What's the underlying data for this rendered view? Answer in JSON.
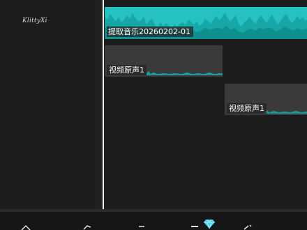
{
  "watermark": {
    "text": "KlittyXi"
  },
  "timeline": {
    "music_clip": {
      "label": "提取音乐20260202-01",
      "color": "#1aa0a0"
    },
    "video_clips": [
      {
        "label": "视频原声1"
      },
      {
        "label": "视频原声1"
      }
    ],
    "playhead_color": "#f2f2f2"
  },
  "toolbar": {
    "icons": [
      "scissors-icon",
      "music-icon",
      "text-icon",
      "layers-icon",
      "diamond-icon",
      "edit-icon"
    ]
  }
}
